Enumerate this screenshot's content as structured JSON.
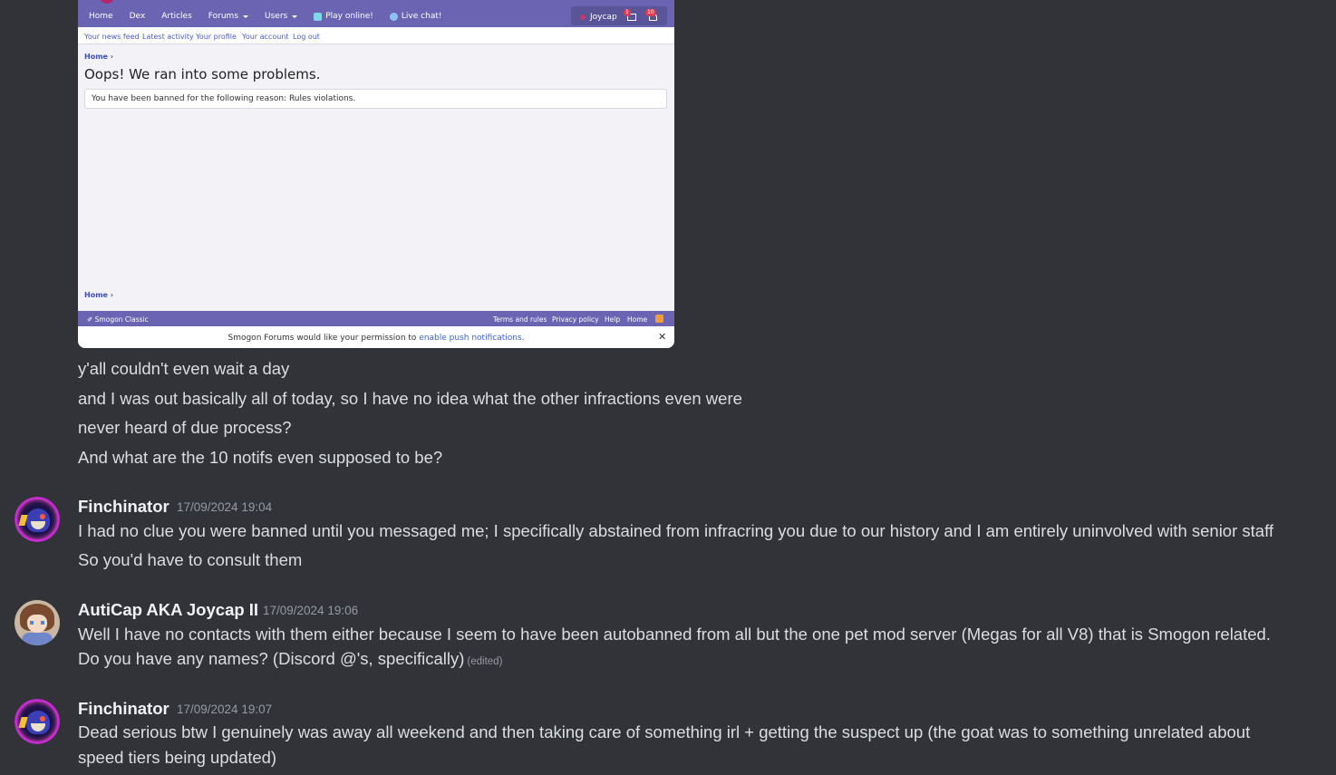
{
  "attachment": {
    "nav": [
      "Home",
      "Dex",
      "Articles",
      "Forums",
      "Users",
      "Play online!",
      "Live chat!"
    ],
    "user": "Joycap",
    "badges": {
      "inbox": "1",
      "alerts": "10"
    },
    "subnav": [
      "Your news feed",
      "Latest activity",
      "Your profile",
      "Your account",
      "Log out"
    ],
    "breadcrumb": "Home",
    "error_title": "Oops! We ran into some problems.",
    "error_message": "You have been banned for the following reason: Rules violations.",
    "footer_left": "Smogon Classic",
    "footer_links": [
      "Terms and rules",
      "Privacy policy",
      "Help",
      "Home"
    ],
    "push_text": "Smogon Forums would like your permission to",
    "push_link": "enable push notifications",
    "push_end": ".",
    "close_glyph": "✕"
  },
  "messages": [
    {
      "text": "y'all couldn't even wait a day"
    },
    {
      "text": "and I was out basically all of today, so I have no idea what the other infractions even were"
    },
    {
      "text": "never heard of due process?"
    },
    {
      "text": "And what are the 10 notifs even supposed to be?"
    }
  ],
  "groups": [
    {
      "author": "Finchinator",
      "timestamp": "17/09/2024 19:04",
      "avatar": "finchinator-avatar",
      "lines": [
        "I had no clue you were banned until you messaged me; I specifically abstained from infracring you due to our history and I am entirely uninvolved with senior staff",
        "So you'd have to consult them"
      ]
    },
    {
      "author": "AutiCap AKA Joycap II",
      "timestamp": "17/09/2024 19:06",
      "avatar": "joycap-avatar",
      "lines": [
        "Well I have no contacts with them either because I seem to have been autobanned from all but the one pet mod server (Megas for all V8) that is Smogon related.",
        "Do you have any names? (Discord @'s, specifically)"
      ],
      "edited": "(edited)"
    },
    {
      "author": "Finchinator",
      "timestamp": "17/09/2024 19:07",
      "avatar": "finchinator-avatar",
      "lines": [
        "Dead serious btw I genuinely was away all weekend and then taking care of something irl + getting the suspect up (the goat was to something unrelated about",
        "speed tiers being updated)"
      ]
    }
  ],
  "colors": {
    "background": "#313338",
    "text": "#dbdee1",
    "timestamp": "#949ba4",
    "forum_purple": "#6a64b3"
  }
}
